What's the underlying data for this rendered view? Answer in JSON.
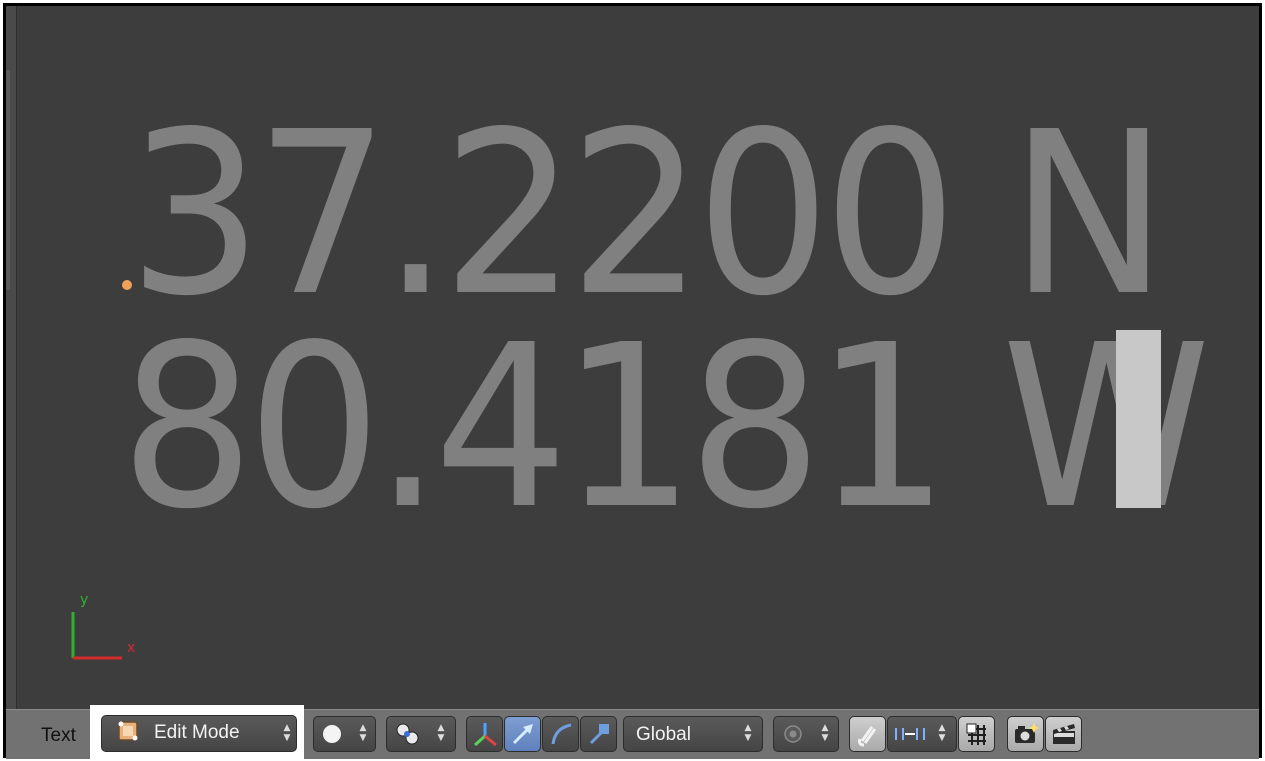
{
  "viewport": {
    "text_line_1": "37.2200 N",
    "text_line_2": "80.4181 W",
    "axis_x_label": "x",
    "axis_y_label": "y"
  },
  "header": {
    "editor_label": "Text",
    "mode_select": {
      "value": "Edit Mode",
      "icon": "edit-mode-icon"
    },
    "viewport_shading": {
      "icon": "solid-sphere-icon"
    },
    "pivot_point": {
      "icon": "pivot-point-icon"
    },
    "manipulator_toggle": {
      "icon": "manipulator-axes-icon"
    },
    "translate_manipulator": {
      "icon": "translate-arrow-icon",
      "active": true
    },
    "rotate_manipulator": {
      "icon": "rotate-arc-icon"
    },
    "scale_manipulator": {
      "icon": "scale-handle-icon"
    },
    "transform_orientation": {
      "value": "Global"
    },
    "proportional_editing": {
      "icon": "proportional-edit-icon"
    },
    "snap_toggle": {
      "icon": "magnet-icon"
    },
    "snap_element": {
      "icon": "snap-increment-icon"
    },
    "snap_target": {
      "icon": "snap-target-icon"
    },
    "render_button": {
      "icon": "camera-render-icon"
    },
    "render_animation_button": {
      "icon": "clapperboard-icon"
    }
  },
  "colors": {
    "viewport_bg": "#3d3d3d",
    "text_color": "#808080",
    "cursor": "#c8c8c8",
    "header_bg": "#727272",
    "active_button": "#6b8cc6"
  }
}
